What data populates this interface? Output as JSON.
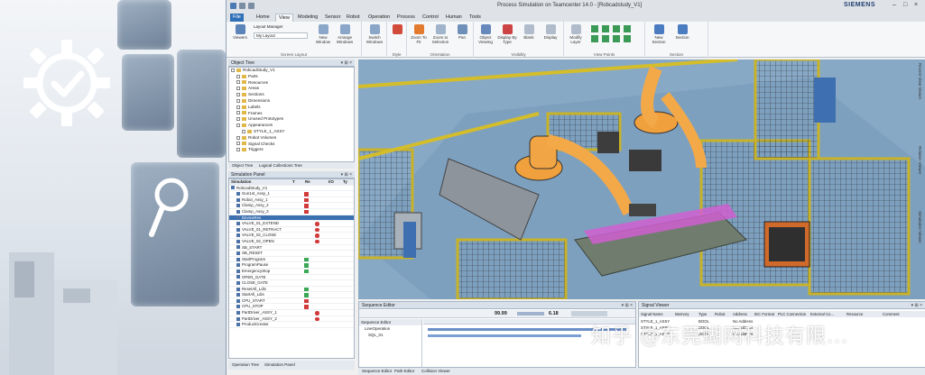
{
  "window": {
    "title": "Process Simulation on Teamcenter 14.0 - [Robcadstudy_V1]",
    "brand": "SIEMENS",
    "controls": [
      "–",
      "□",
      "×"
    ]
  },
  "tabs": [
    "File",
    "Home",
    "View",
    "Modeling",
    "Sensor",
    "Robot",
    "Operation",
    "Process",
    "Control",
    "Human",
    "Tools"
  ],
  "active_tab": "View",
  "ribbon": {
    "groups": [
      {
        "label": "Screen Layout",
        "buttons": [
          "Viewers",
          "Layout Manager",
          "My Layout",
          "New Window",
          "Arrange Windows",
          "Switch Windows"
        ]
      },
      {
        "label": "Style",
        "buttons": [
          "Style"
        ]
      },
      {
        "label": "Orientation",
        "buttons": [
          "Zoom To Fit",
          "Zoom to Selection",
          "Pan"
        ]
      },
      {
        "label": "Visibility",
        "buttons": [
          "Object Viewing",
          "Display By Type",
          "Blank",
          "Display"
        ]
      },
      {
        "label": "View Points",
        "buttons": [
          "Modify Layer"
        ]
      },
      {
        "label": "Section",
        "buttons": [
          "New Section",
          "Section"
        ]
      }
    ]
  },
  "object_tree": {
    "title": "Object Tree",
    "items": [
      {
        "label": "RobcadStudy_V1",
        "level": 0
      },
      {
        "label": "Parts",
        "level": 1
      },
      {
        "label": "Resources",
        "level": 1
      },
      {
        "label": "Areas",
        "level": 1
      },
      {
        "label": "Sections",
        "level": 1
      },
      {
        "label": "Dimensions",
        "level": 1
      },
      {
        "label": "Labels",
        "level": 1
      },
      {
        "label": "Frames",
        "level": 1
      },
      {
        "label": "Unused Prototypes",
        "level": 1
      },
      {
        "label": "Appearances",
        "level": 1
      },
      {
        "label": "STYLE_1_ASSY",
        "level": 2
      },
      {
        "label": "Robot Volumes",
        "level": 1
      },
      {
        "label": "Signal Checks",
        "level": 1
      },
      {
        "label": "Triggers",
        "level": 1
      }
    ],
    "tabs": [
      "Object Tree",
      "Logical Collections Tree"
    ]
  },
  "simulation_panel": {
    "title": "Simulation Panel",
    "columns": [
      "Simulation",
      "T",
      "Re",
      "",
      "I/O",
      "Ty"
    ],
    "rows": [
      {
        "label": "RobcadStudy_V1",
        "mark": "none",
        "red": false,
        "selected": false
      },
      {
        "label": "Gun1st_Assy_1",
        "mark": "red",
        "red": false,
        "selected": false
      },
      {
        "label": "Robot_Assy_1",
        "mark": "red",
        "red": false,
        "selected": false
      },
      {
        "label": "Clamp_Assy_2",
        "mark": "red",
        "red": false,
        "selected": false
      },
      {
        "label": "Clamp_Assy_3",
        "mark": "red",
        "red": false,
        "selected": false
      },
      {
        "label": "DeviceRes",
        "mark": "none",
        "red": false,
        "selected": true
      },
      {
        "label": "VALVE_01_EXTEND",
        "mark": "none",
        "red": true,
        "selected": false
      },
      {
        "label": "VALVE_01_RETRACT",
        "mark": "none",
        "red": true,
        "selected": false
      },
      {
        "label": "VALVE_02_CLOSE",
        "mark": "none",
        "red": true,
        "selected": false
      },
      {
        "label": "VALVE_02_OPEN",
        "mark": "none",
        "red": true,
        "selected": false
      },
      {
        "label": "SB_START",
        "mark": "none",
        "red": false,
        "selected": false
      },
      {
        "label": "SB_RESET",
        "mark": "none",
        "red": false,
        "selected": false
      },
      {
        "label": "StartProgram",
        "mark": "green",
        "red": false,
        "selected": false
      },
      {
        "label": "ProgramPause",
        "mark": "green",
        "red": false,
        "selected": false
      },
      {
        "label": "EmergencyStop",
        "mark": "green",
        "red": false,
        "selected": false
      },
      {
        "label": "OPEN_GATE",
        "mark": "none",
        "red": false,
        "selected": false
      },
      {
        "label": "CLOSE_GATE",
        "mark": "none",
        "red": false,
        "selected": false
      },
      {
        "label": "ResetAll_Ldis",
        "mark": "green",
        "red": false,
        "selected": false
      },
      {
        "label": "StartAll_Ldis",
        "mark": "green",
        "red": false,
        "selected": false
      },
      {
        "label": "CPU_START",
        "mark": "red",
        "red": false,
        "selected": false
      },
      {
        "label": "CPU_STOP",
        "mark": "red",
        "red": false,
        "selected": false
      },
      {
        "label": "PartDriver_ASSY_1",
        "mark": "none",
        "red": true,
        "selected": false
      },
      {
        "label": "PartDriver_ASSY_2",
        "mark": "none",
        "red": true,
        "selected": false
      },
      {
        "label": "ProductCreator",
        "mark": "none",
        "red": false,
        "selected": false
      }
    ],
    "tabs": [
      "Operation Tree",
      "Simulation Panel"
    ]
  },
  "viewport": {
    "side_labels": [
      "Recent View Viewer",
      "Relation Viewer",
      "Simulation Viewer"
    ]
  },
  "sequence_editor": {
    "title": "Sequence Editor",
    "readout_time": "99.99",
    "readout_speed": "6.18",
    "column": "Sequence Editor",
    "rows": [
      "LineOperation",
      "SQL_01"
    ],
    "tabs": [
      "Sequence Editor",
      "Path Editor",
      "Collision Viewer"
    ]
  },
  "signal_viewer": {
    "title": "Signal Viewer",
    "columns": [
      "Signal Name",
      "Memory",
      "Type",
      "Robot",
      "Address",
      "IEC Format",
      "PLC Connection",
      "External Co...",
      "Resource",
      "Comment"
    ],
    "rows": [
      [
        "STYLE_1_ASSY",
        "",
        "BOOL",
        "No Address",
        ""
      ],
      [
        "STYLE_1_ASSY",
        "",
        "BOOL",
        "No Address",
        ""
      ],
      [
        "STYLE_1_ASSY",
        "",
        "BOOL",
        "No Address",
        ""
      ]
    ]
  },
  "watermark": "知乎 @东莞蝴网科技有限..."
}
